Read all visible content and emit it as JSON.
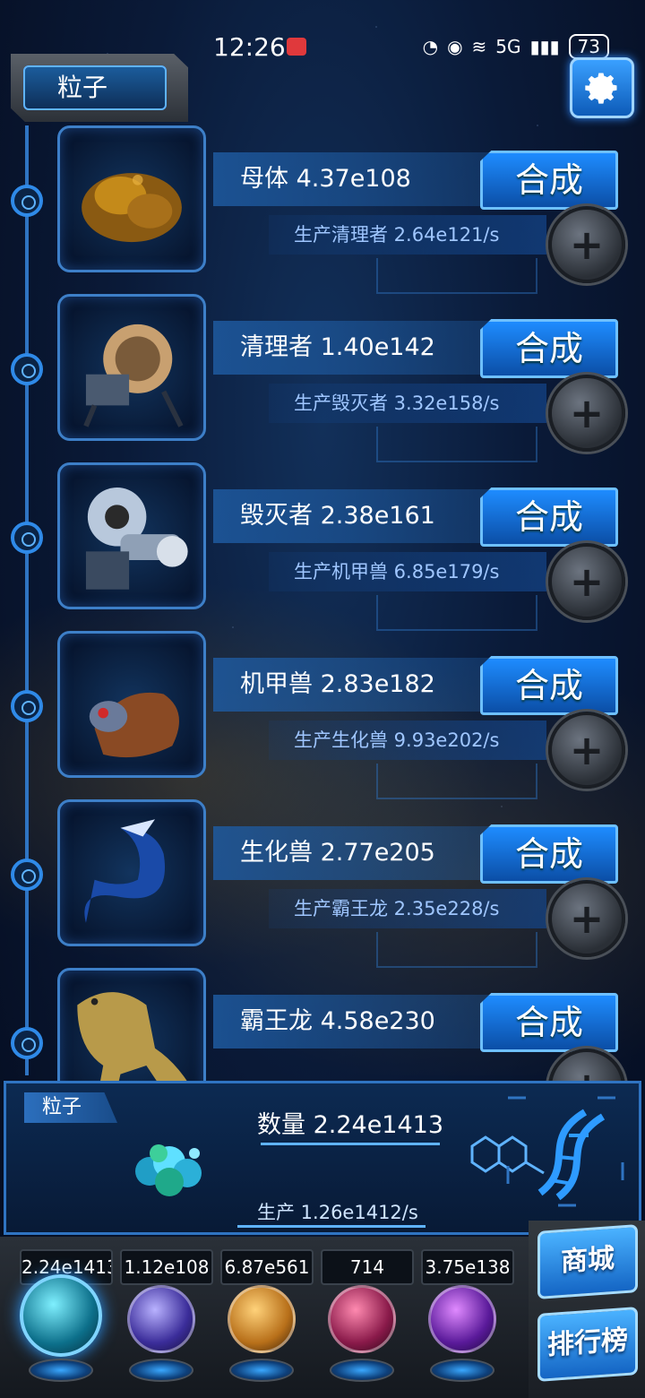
{
  "status_bar": {
    "time": "12:26",
    "battery": "73",
    "network": "5G"
  },
  "header": {
    "title": "粒子",
    "settings_icon": "gear-icon"
  },
  "units": [
    {
      "name": "母体",
      "count": "4.37e108",
      "label": "母体 4.37e108",
      "produce": "生产清理者 2.64e121/s",
      "craft_label": "合成"
    },
    {
      "name": "清理者",
      "count": "1.40e142",
      "label": "清理者 1.40e142",
      "produce": "生产毁灭者 3.32e158/s",
      "craft_label": "合成"
    },
    {
      "name": "毁灭者",
      "count": "2.38e161",
      "label": "毁灭者 2.38e161",
      "produce": "生产机甲兽 6.85e179/s",
      "craft_label": "合成"
    },
    {
      "name": "机甲兽",
      "count": "2.83e182",
      "label": "机甲兽 2.83e182",
      "produce": "生产生化兽 9.93e202/s",
      "craft_label": "合成"
    },
    {
      "name": "生化兽",
      "count": "2.77e205",
      "label": "生化兽 2.77e205",
      "produce": "生产霸王龙 2.35e228/s",
      "craft_label": "合成"
    },
    {
      "name": "霸王龙",
      "count": "4.58e230",
      "label": "霸王龙 4.58e230",
      "produce": "",
      "craft_label": "合成"
    }
  ],
  "particle_panel": {
    "tag": "粒子",
    "quantity": "数量 2.24e1413",
    "rate": "生产 1.26e1412/s"
  },
  "resources": {
    "values": [
      "2.24e1413",
      "1.12e108",
      "6.87e561",
      "714",
      "3.75e138"
    ],
    "orbs": [
      "particle-orb-icon",
      "lightning-orb-icon",
      "fire-orb-icon",
      "brain-orb-icon",
      "vortex-orb-icon"
    ]
  },
  "side_buttons": {
    "shop": "商城",
    "rank": "排行榜"
  },
  "colors": {
    "accent": "#1e8cff",
    "panel_border": "#2f74c2",
    "text_secondary": "#9fc6ff"
  }
}
